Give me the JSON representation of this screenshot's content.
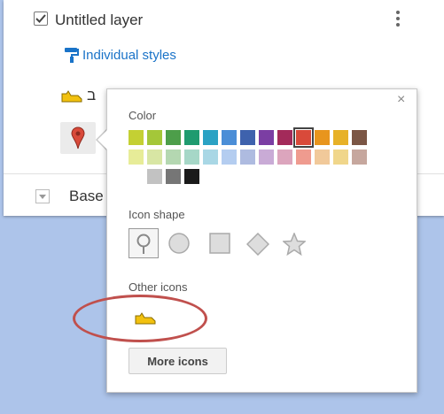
{
  "layer": {
    "title": "Untitled layer",
    "styles_link": "Individual styles",
    "rows": [
      {
        "label": "ב",
        "icon": "yellow-shoe-icon"
      },
      {
        "label": "",
        "icon": "red-pin-icon"
      }
    ],
    "base_label": "Base"
  },
  "popover": {
    "close_label": "×",
    "color_label": "Color",
    "colors_row1": [
      "#c4d033",
      "#a4c739",
      "#4d9e4a",
      "#1f9b6f",
      "#2ba2c4",
      "#4b8ed7",
      "#3e62ad",
      "#7b3ea3",
      "#a32a5a",
      "#d94a3a",
      "#e8951d",
      "#e7b127",
      "#7b5645"
    ],
    "colors_row2": [
      "#e7ec98",
      "#d8e6a4",
      "#b4d7b1",
      "#a6d7c7",
      "#a9d7e5",
      "#b4cdf0",
      "#aebbe0",
      "#c9abd6",
      "#dca5bd",
      "#ef9b8f",
      "#f1c99a",
      "#f0d68b",
      "#c6a79e"
    ],
    "colors_row3": [
      "#c2c2c2",
      "#767676",
      "#1a1a1a"
    ],
    "selected_color": "#d94a3a",
    "icon_shape_label": "Icon shape",
    "shapes": [
      "pin-shape-icon",
      "circle-shape-icon",
      "square-shape-icon",
      "diamond-shape-icon",
      "star-shape-icon"
    ],
    "other_icons_label": "Other icons",
    "more_icons_label": "More icons"
  }
}
